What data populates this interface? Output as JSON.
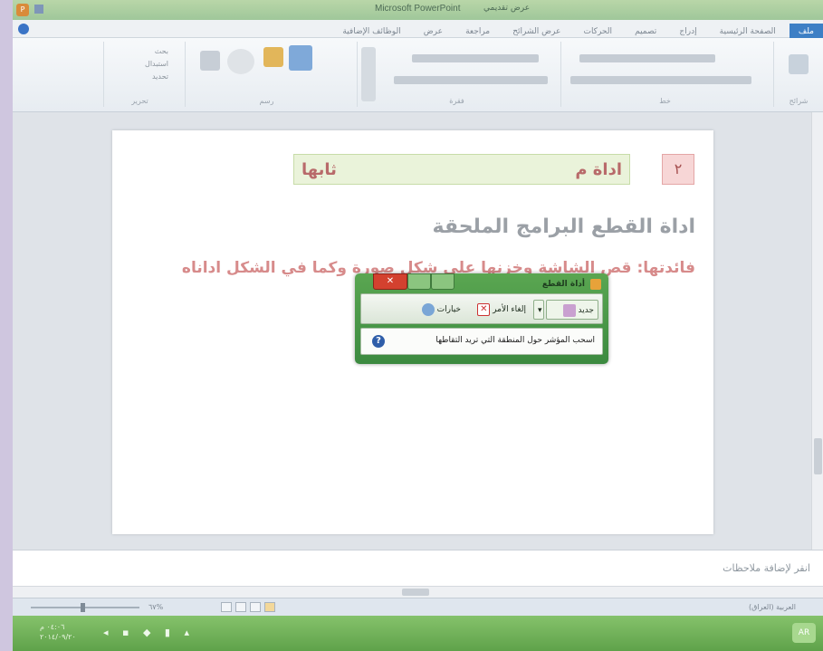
{
  "window": {
    "title": "Microsoft PowerPoint",
    "document_name": "عرض تقديمي"
  },
  "ribbon_tabs": [
    "ملف",
    "الصفحة الرئيسية",
    "إدراج",
    "تصميم",
    "الحركات",
    "عرض الشرائح",
    "مراجعة",
    "عرض",
    "الوظائف الإضافية"
  ],
  "ribbon_groups": [
    "تحرير",
    "رسم",
    "فقرة",
    "خط",
    "شرائح"
  ],
  "ribbon_edit": {
    "find": "بحث",
    "replace": "استبدال",
    "select": "تحديد"
  },
  "slide": {
    "number": "٢",
    "banner_text": "اداة م",
    "banner_tail": "ثابها",
    "heading": "اداة القطع                               البرامج الملحقة",
    "benefit": "فائدتها: قص الشاشة وخزنها على شكل صورة وكما في الشكل اداناه"
  },
  "snipping_tool": {
    "title": "أداة القطع",
    "new_label": "جديد",
    "cancel_label": "إلغاء الأمر",
    "options_label": "خيارات",
    "status": "اسحب المؤشر حول المنطقة التي تريد التقاطها"
  },
  "notes": {
    "placeholder": "انقر لإضافة ملاحظات"
  },
  "statusbar": {
    "zoom": "٦٧%",
    "language": "العربية (العراق)"
  },
  "taskbar": {
    "time": "٠٤:٠٦ م",
    "date": "٢٠١٤/٠٩/٢٠"
  }
}
